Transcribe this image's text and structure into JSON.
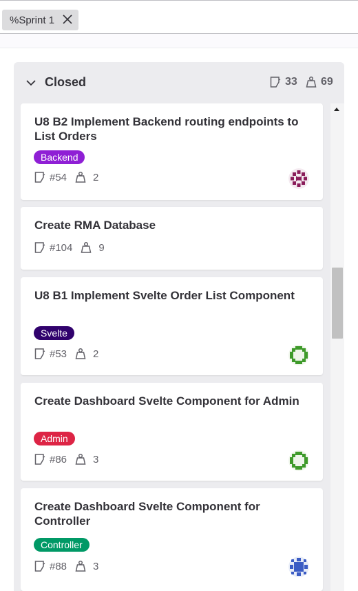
{
  "filter": {
    "token_label": "%Sprint 1"
  },
  "list": {
    "title": "Closed",
    "issue_count": "33",
    "weight_total": "69"
  },
  "cards": [
    {
      "title": "U8 B2 Implement Backend routing endpoints to List Orders",
      "label": "Backend",
      "label_color": "#8f1fd5",
      "issue": "#54",
      "weight": "2",
      "avatar": "purple-identicon"
    },
    {
      "title": "Create RMA Database",
      "issue": "#104",
      "weight": "9"
    },
    {
      "title": "U8 B1 Implement Svelte Order List Component",
      "label": "Svelte",
      "label_color": "#31026d",
      "issue": "#53",
      "weight": "2",
      "avatar": "green-identicon"
    },
    {
      "title": "Create Dashboard Svelte Component for Admin",
      "label": "Admin",
      "label_color": "#dd2445",
      "issue": "#86",
      "weight": "3",
      "avatar": "green-identicon"
    },
    {
      "title": "Create Dashboard Svelte Component for Controller",
      "label": "Controller",
      "label_color": "#009966",
      "issue": "#88",
      "weight": "3",
      "avatar": "blue-identicon"
    }
  ]
}
